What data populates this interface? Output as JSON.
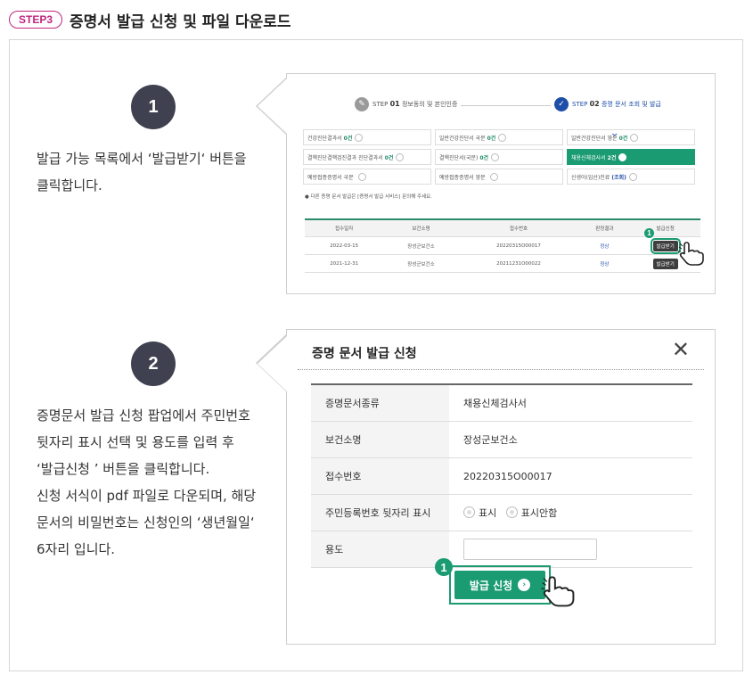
{
  "header": {
    "step_badge": "STEP3",
    "title": "증명서 발급 신청 및 파일 다운로드"
  },
  "step1": {
    "number": "1",
    "description_lines": [
      "발급 가능 목록에서 ‘발급받기‘ 버튼을",
      "클릭합니다."
    ],
    "screenshot": {
      "steps": [
        {
          "prefix": "STEP",
          "num": "01",
          "label": "정보동의 및 본인인증"
        },
        {
          "prefix": "STEP",
          "num": "02",
          "label": "증명 문서 조회 및 발급"
        }
      ],
      "cells": [
        {
          "label": "건강진단결과서",
          "count": "0건"
        },
        {
          "label": "일반건강진단서 국문",
          "count": "0건"
        },
        {
          "label": "일반건강진단서 영문",
          "count": "0건"
        },
        {
          "label": "결핵진단결핵검진결과 진단결과서",
          "count": "0건"
        },
        {
          "label": "결핵진단서(국문)",
          "count": "0건"
        },
        {
          "label": "채용신체검사서",
          "count": "2건"
        },
        {
          "label": "예방접종증명서 국문",
          "count": ""
        },
        {
          "label": "예방접종증명서 영문",
          "count": ""
        },
        {
          "label": "신생아(임산)진료",
          "count": "(조회)"
        }
      ],
      "notice": "● 다른 증명 문서 발급은 [증명서 발급 서비스] 문의해 주세요.",
      "table_headers": [
        "접수일자",
        "보건소명",
        "접수번호",
        "판정결과",
        "발급신청"
      ],
      "rows": [
        {
          "date": "2022-03-15",
          "center": "장성군보건소",
          "num": "20220315O00017",
          "result": "정상",
          "button": "발급받기"
        },
        {
          "date": "2021-12-31",
          "center": "장성군보건소",
          "num": "20211231O00022",
          "result": "정상",
          "button": "발급받기"
        }
      ],
      "badge": "1"
    }
  },
  "step2": {
    "number": "2",
    "description_lines": [
      "증명문서 발급 신청 팝업에서 주민번호",
      "뒷자리 표시 선택 및 용도를 입력 후",
      "‘발급신청 ’ 버튼을 클릭합니다."
    ],
    "description_lines2": [
      "신청 서식이 pdf 파일로 다운되며, 해당",
      "문서의 비밀번호는 신청인의 ‘생년월일‘",
      "6자리 입니다."
    ],
    "popup": {
      "title": "증명 문서 발급 신청",
      "close": "✕",
      "rows": [
        {
          "label": "증명문서종류",
          "value": "채용신체검사서"
        },
        {
          "label": "보건소명",
          "value": "장성군보건소"
        },
        {
          "label": "접수번호",
          "value": "20220315O00017"
        }
      ],
      "rrn_label": "주민등록번호 뒷자리 표시",
      "rrn_options": [
        "표시",
        "표시안함"
      ],
      "use_label": "용도",
      "use_value": "",
      "apply_label": "발급 신청",
      "badge": "1"
    }
  },
  "colors": {
    "accent": "#1a9b72",
    "step_badge": "#c0267f",
    "circle": "#3f4150",
    "step_active": "#1d4ea8"
  },
  "icons": [
    "edit-icon",
    "check-icon",
    "chevron-down-icon",
    "pointer-hand-icon",
    "close-icon",
    "arrow-right-icon"
  ]
}
